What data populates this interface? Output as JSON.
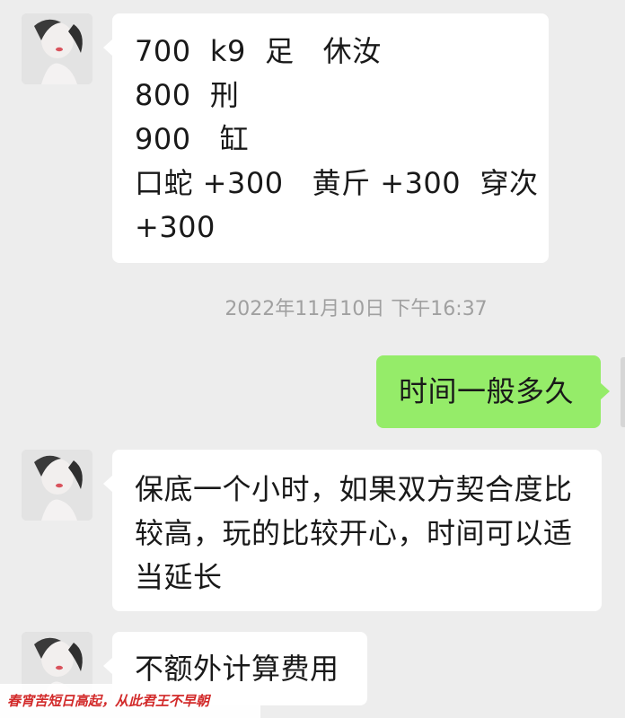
{
  "messages": [
    {
      "side": "left",
      "lines": [
        "700  k9  足   休汝",
        "800  刑",
        "900   缸",
        "口蛇 +300   黄斤 +300  穿次",
        "+300"
      ]
    },
    {
      "side": "right",
      "lines": [
        "时间一般多久"
      ]
    },
    {
      "side": "left",
      "lines": [
        "保底一个小时，如果双方契合度比",
        "较高，玩的比较开心，时间可以适",
        "当延长"
      ]
    },
    {
      "side": "left",
      "lines": [
        "不额外计算费用"
      ]
    }
  ],
  "timestamp": "2022年11月10日 下午16:37",
  "watermark": "春宵苦短日高起，从此君王不早朝",
  "colors": {
    "background": "#ededed",
    "incoming_bubble": "#ffffff",
    "outgoing_bubble": "#95ec69",
    "watermark_text": "#d22a2a"
  },
  "icons": {
    "avatar": "contact-avatar-photo"
  }
}
